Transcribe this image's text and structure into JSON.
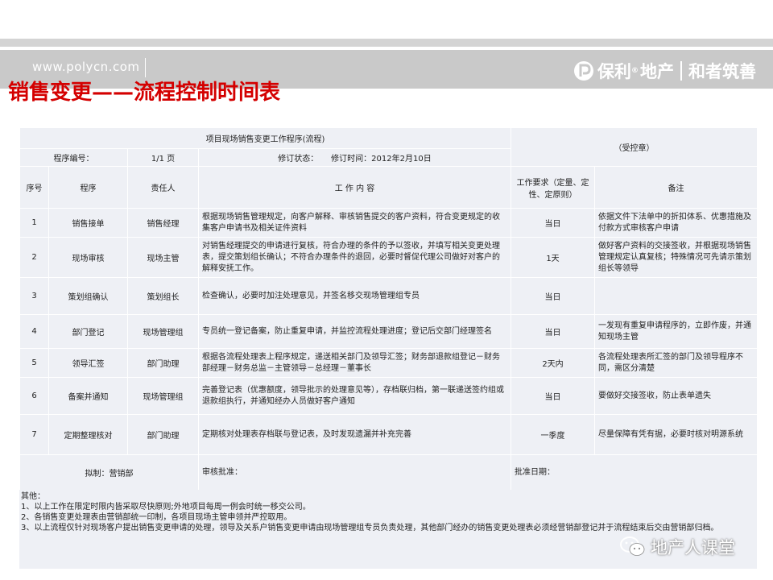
{
  "header": {
    "url": "www.polycn.com",
    "logo_brand": "保利",
    "logo_reg": "®",
    "logo_estate": "地产",
    "logo_slogan": "和者筑善"
  },
  "title": "销售变更——流程控制时间表",
  "form": {
    "program_title": "项目现场销售变更工作程序(流程)",
    "controlled": "（受控章）",
    "program_no_label": "程序编号：",
    "page": "1/1 页",
    "revision_label": "修订状态：",
    "revision_time_label": "修订时间：",
    "revision_time_value": "2012年2月10日"
  },
  "columns": {
    "no": "序号",
    "program": "程序",
    "owner": "责任人",
    "content": "工 作 内 容",
    "requirement": "工作要求（定量、定性、定原则）",
    "remark": "备注"
  },
  "rows": [
    {
      "no": "1",
      "program": "销售接单",
      "owner": "销售经理",
      "content": "根据现场销售管理规定，向客户解释、审核销售提交的客户资料，符合变更规定的收集客户申请书及相关证件资料",
      "req": "当日",
      "remark": "依据文件下法单中的折扣体系、优惠措施及付款方式审核客户申请"
    },
    {
      "no": "2",
      "program": "现场审核",
      "owner": "现场主管",
      "content": "对销售经理提交的申请进行复核，符合办理的条件的予以签收，并填写相关变更处理表，提交策划组长确认；不符合办理条件的退回，必要时督促代理公司做好对客户的解释安抚工作。",
      "req": "1天",
      "remark": "做好客户资料的交接签收，并根据现场销售管理规定认真复核；特殊情况可先请示策划组长等领导"
    },
    {
      "no": "3",
      "program": "策划组确认",
      "owner": "策划组长",
      "content": "检查确认，必要时加注处理意见，并签名移交现场管理组专员",
      "req": "当日",
      "remark": ""
    },
    {
      "no": "4",
      "program": "部门登记",
      "owner": "现场管理组",
      "content": "专员统一登记备案，防止重复申请，并监控流程处理进度；登记后交部门经理签名",
      "req": "当日",
      "remark": "一发现有重复申请程序的，立即作废，并通知现场主管"
    },
    {
      "no": "5",
      "program": "领导汇签",
      "owner": "部门助理",
      "content": "根据各流程处理表上程序规定，递送相关部门及领导汇签；财务部退款组登记－财务部经理－财务总监－主管领导－总经理－董事长",
      "req": "2天内",
      "remark": "各流程处理表所汇签的部门及领导程序不同，需区分清楚"
    },
    {
      "no": "6",
      "program": "备案并通知",
      "owner": "现场管理组",
      "content": "完善登记表（优惠额度，领导批示的处理意见等），存档联归档，第一联递送签约组或退款组执行，并通知经办人员做好客户通知",
      "req": "当日",
      "remark": "要做好交接签收，防止表单遗失"
    },
    {
      "no": "7",
      "program": "定期整理核对",
      "owner": "部门助理",
      "content": "定期核对处理表存档联与登记表，及时发现遗漏并补充完善",
      "req": "一季度",
      "remark": "尽量保障有凭有据，必要时核对明源系统"
    }
  ],
  "footer": {
    "drafted": "拟制：营销部",
    "review": "审核批准：",
    "approve_date": "批准日期："
  },
  "notes": {
    "heading": "其他：",
    "items": [
      "1、以上工作在限定时限内皆采取尽快原则;外地项目每周一例会时统一移交公司。",
      "2、各销售变更处理表由营销部统一印制，各项目现场主管申领并严控取用。",
      "3、以上流程仅针对现场客户提出销售变更申请的处理，领导及关系户销售变更申请由现场管理组专员负责处理，其他部门经办的销售变更处理表必须经营销部登记并于流程结束后交由营销部归档。"
    ]
  },
  "watermark": "地产人课堂",
  "colors": {
    "title_red": "#d40000",
    "banner_gray": "#c9c9c9",
    "table_bg": "#eef0f5"
  }
}
